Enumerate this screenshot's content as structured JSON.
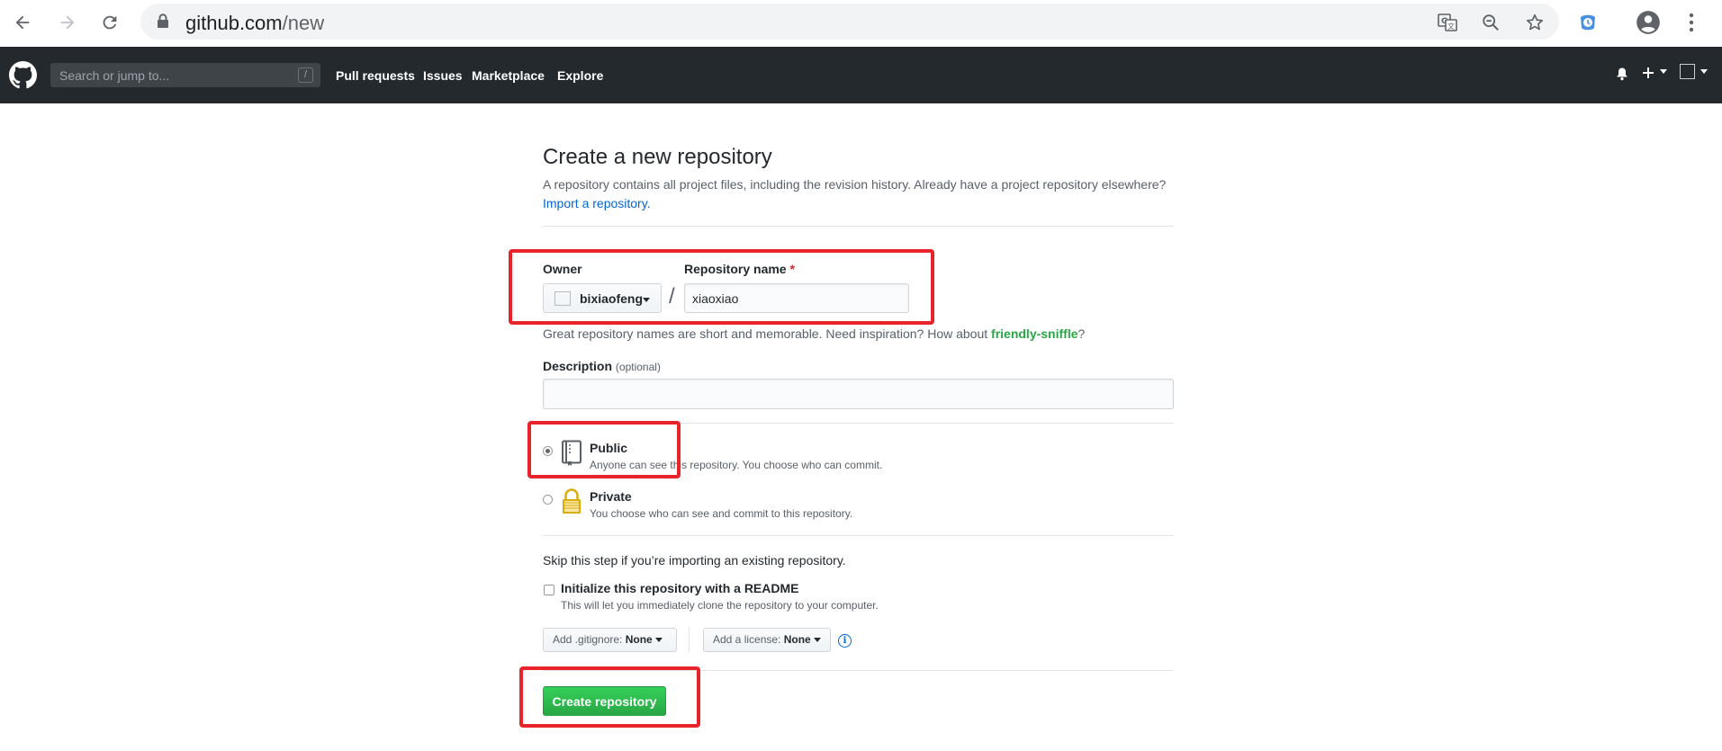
{
  "browser": {
    "url_host": "github.com",
    "url_path": "/new"
  },
  "header": {
    "search_placeholder": "Search or jump to...",
    "search_shortcut": "/",
    "nav": [
      "Pull requests",
      "Issues",
      "Marketplace",
      "Explore"
    ]
  },
  "page": {
    "title": "Create a new repository",
    "subtitle": "A repository contains all project files, including the revision history. Already have a project repository elsewhere?",
    "import_link": "Import a repository."
  },
  "form": {
    "owner_label": "Owner",
    "owner_value": "bixiaofeng",
    "repo_label": "Repository name",
    "required_mark": "*",
    "separator": "/",
    "repo_value": "xiaoxiao",
    "name_hint_prefix": "Great repository names are short and memorable. Need inspiration? How about ",
    "name_suggestion": "friendly-sniffle",
    "name_hint_suffix": "?",
    "description_label": "Description",
    "description_optional": "(optional)",
    "description_value": "",
    "visibility": [
      {
        "title": "Public",
        "desc": "Anyone can see this repository. You choose who can commit.",
        "checked": true
      },
      {
        "title": "Private",
        "desc": "You choose who can see and commit to this repository.",
        "checked": false
      }
    ],
    "skip_note": "Skip this step if you’re importing an existing repository.",
    "readme_label": "Initialize this repository with a README",
    "readme_desc": "This will let you immediately clone the repository to your computer.",
    "gitignore_prefix": "Add .gitignore:",
    "gitignore_value": "None",
    "license_prefix": "Add a license:",
    "license_value": "None",
    "info_glyph": "i",
    "submit_label": "Create repository"
  },
  "colors": {
    "header_bg": "#24292e",
    "primary_green": "#28a745",
    "link_blue": "#0366d6",
    "annotation_red": "#e8242a"
  }
}
